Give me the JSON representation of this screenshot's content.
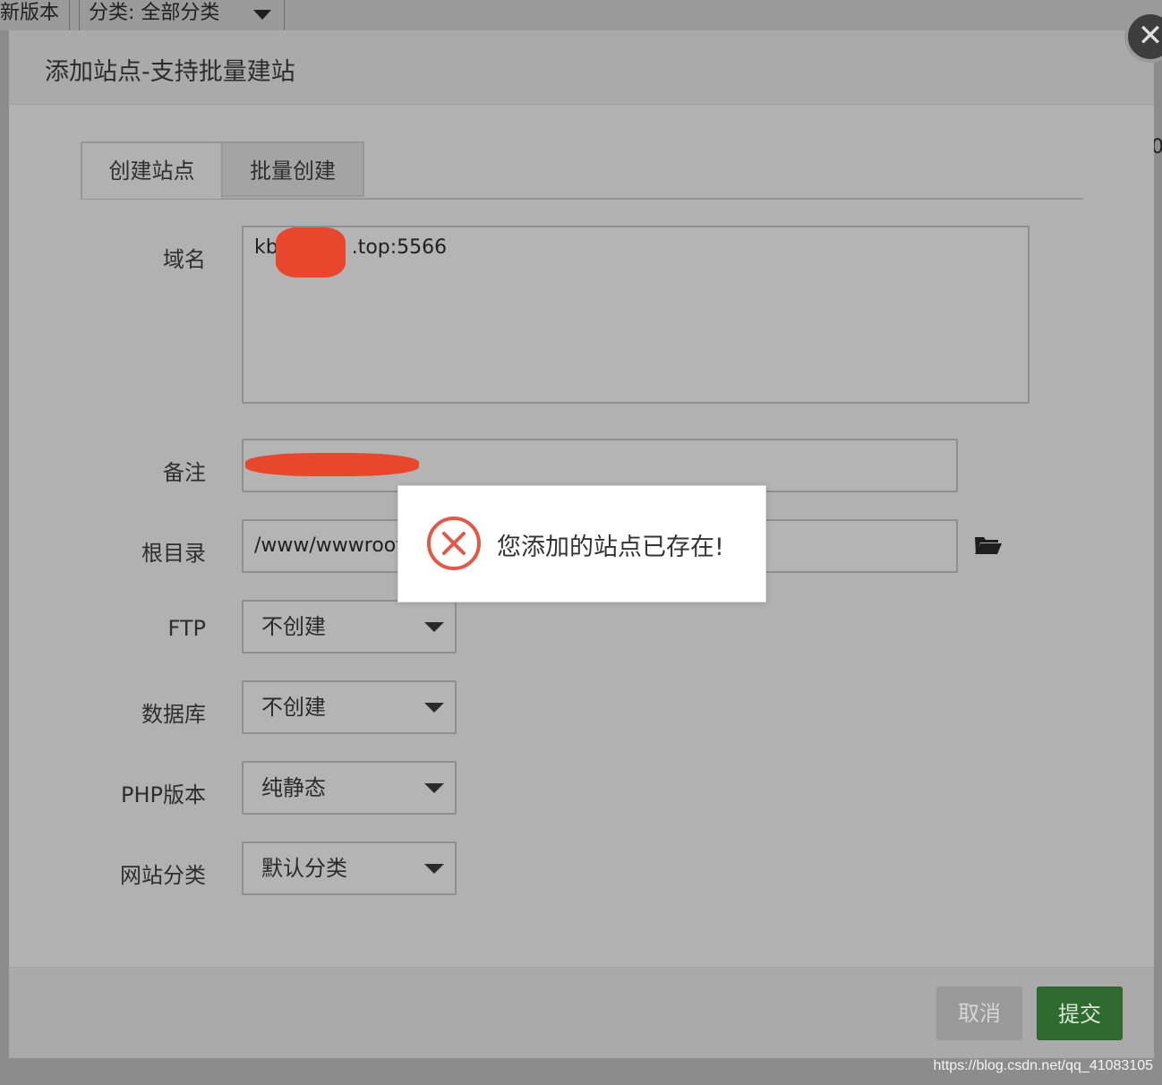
{
  "background": {
    "tab_version": "新版本",
    "tab_category": "分类: 全部分类",
    "right_edge_char": "0"
  },
  "modal": {
    "title": "添加站点-支持批量建站",
    "close_glyph": "✕",
    "tabs": [
      {
        "label": "创建站点",
        "active": true
      },
      {
        "label": "批量创建",
        "active": false
      }
    ],
    "fields": {
      "domain_label": "域名",
      "domain_value_prefix": "kb",
      "domain_value_suffix": ".top:5566",
      "note_label": "备注",
      "root_label": "根目录",
      "root_value": "/www/wwwroot/",
      "ftp_label": "FTP",
      "ftp_value": "不创建",
      "db_label": "数据库",
      "db_value": "不创建",
      "php_label": "PHP版本",
      "php_value": "纯静态",
      "category_label": "网站分类",
      "category_value": "默认分类"
    },
    "footer": {
      "cancel_label": "取消",
      "submit_label": "提交"
    }
  },
  "toast": {
    "message": "您添加的站点已存在!",
    "icon": "error-circle-x-icon",
    "icon_color": "#e05a4a"
  },
  "watermark": "https://blog.csdn.net/qq_41083105",
  "colors": {
    "submit": "#2f6b2f",
    "error": "#e05a4a",
    "redaction": "#e8462d"
  }
}
